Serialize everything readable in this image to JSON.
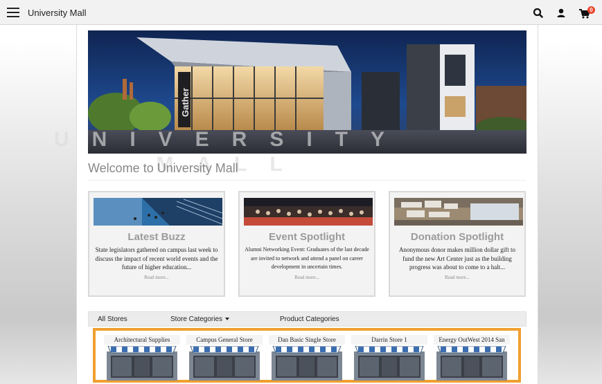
{
  "topbar": {
    "title": "University Mall",
    "cart_count": "0"
  },
  "icons": {
    "menu": "hamburger-menu-icon",
    "search": "search-icon",
    "account": "user-icon",
    "cart": "shopping-cart-icon"
  },
  "banner": {
    "sign_text": "Gather",
    "overlay_text": "UNIVERSITY MALL"
  },
  "welcome": "Welcome to University Mall",
  "cards": [
    {
      "title": "Latest Buzz",
      "body": "State legislators gathered on campus last week to discuss the impact of recent world events and the future of higher education...",
      "more": "Read more..."
    },
    {
      "title": "Event Spotlight",
      "body": "Alumni Networking Event: Graduates of the last decade are invited to network and attend a panel on career development in uncertain times.",
      "more": "Read more..."
    },
    {
      "title": "Donation Spotlight",
      "body": "Anonymous donor makes million dollar gift to fund the new Art Center just as the building progress was about to come to a halt...",
      "more": "Read more..."
    }
  ],
  "nav": {
    "all_stores": "All Stores",
    "store_categories": "Store Categories",
    "product_categories": "Product Categories"
  },
  "stores": [
    "Architectural Supplies",
    "Campus General Store",
    "Dan Basic Single Store",
    "Darrin Store 1",
    "Energy OutWest 2014 San"
  ],
  "colors": {
    "accent_border": "#f0a030",
    "badge": "#e8452c",
    "card_title": "#9b9b9b"
  }
}
